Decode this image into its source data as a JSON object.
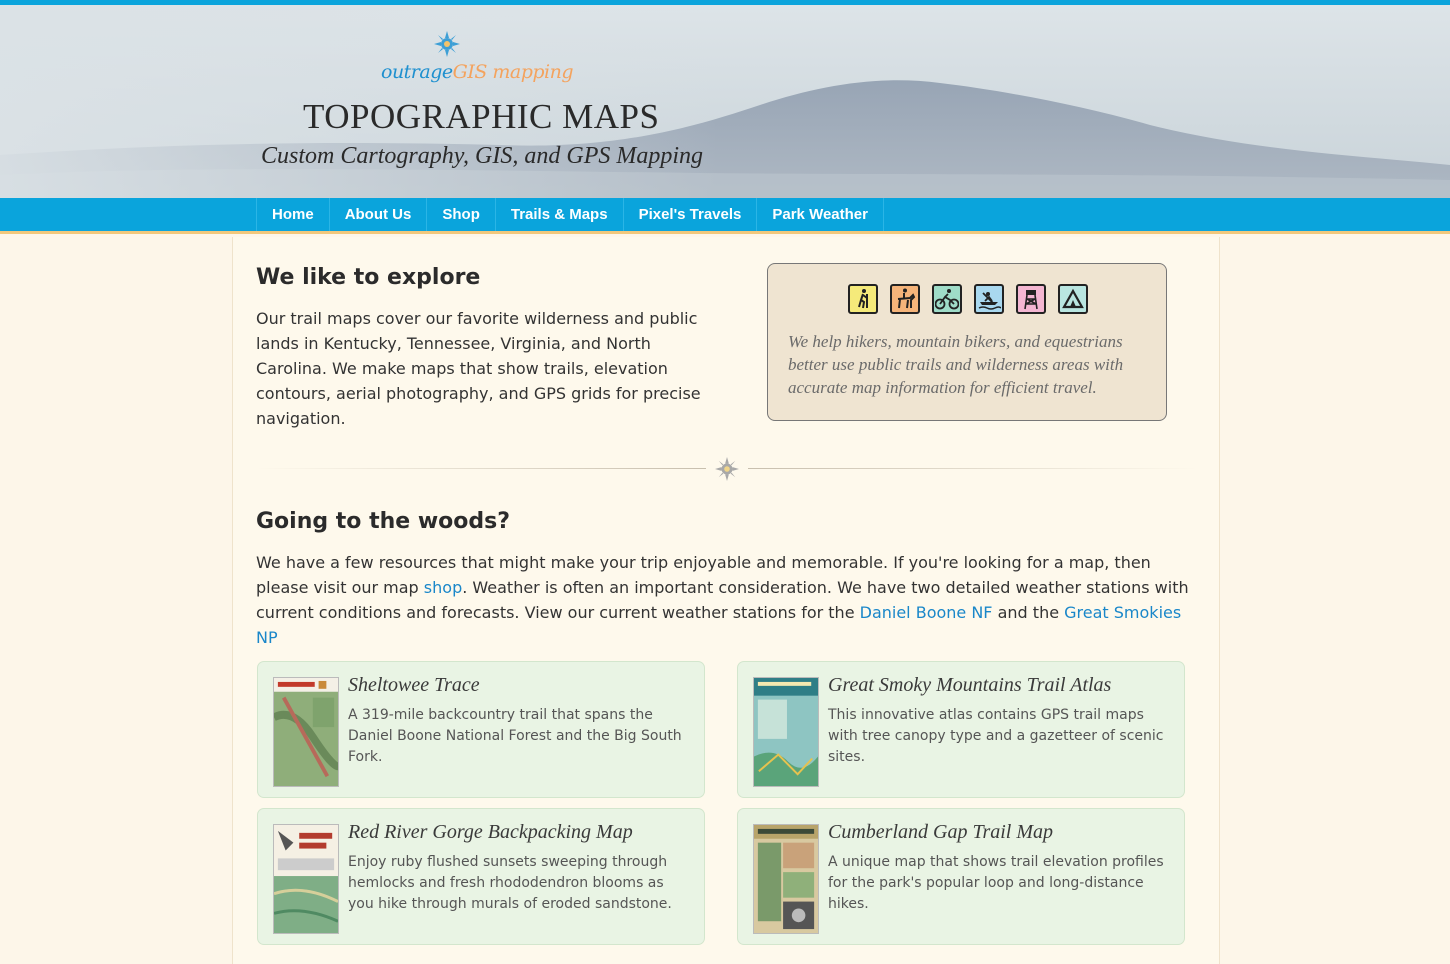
{
  "header": {
    "logo_part1": "outrage",
    "logo_part2": "GIS mapping",
    "title": "TOPOGRAPHIC MAPS",
    "subtitle": "Custom Cartography, GIS, and GPS Mapping"
  },
  "nav": {
    "items": [
      "Home",
      "About Us",
      "Shop",
      "Trails & Maps",
      "Pixel's Travels",
      "Park Weather"
    ]
  },
  "explore": {
    "heading": "We like to explore",
    "body": "Our trail maps cover our favorite wilderness and public lands in Kentucky, Tennessee, Virginia, and North Carolina. We make maps that show trails, elevation contours, aerial photography, and GPS grids for precise navigation."
  },
  "callout": {
    "icons": [
      {
        "name": "hiking-icon",
        "color": "#f5ea7a"
      },
      {
        "name": "horseback-icon",
        "color": "#f5b47a"
      },
      {
        "name": "biking-icon",
        "color": "#9fdcc8"
      },
      {
        "name": "boating-icon",
        "color": "#a9d8ef"
      },
      {
        "name": "firetower-icon",
        "color": "#f4b6d2"
      },
      {
        "name": "camping-icon",
        "color": "#b9e6e1"
      }
    ],
    "text": "We help hikers, mountain bikers, and equestrians better use public trails and wilderness areas with accurate map information for efficient travel."
  },
  "woods": {
    "heading": "Going to the woods?",
    "p1": "We have a few resources that might make your trip enjoyable and memorable. If you're looking for a map, then please visit our map ",
    "link_shop": "shop",
    "p2": ". Weather is often an important consideration. We have two detailed weather stations with current conditions and forecasts. View our current weather stations for the ",
    "link_boone": "Daniel Boone NF",
    "p3": " and the ",
    "link_smokies": "Great Smokies NP"
  },
  "cards": [
    {
      "title": "Sheltowee Trace",
      "desc": "A 319-mile backcountry trail that spans the Daniel Boone National Forest and the Big South Fork."
    },
    {
      "title": "Great Smoky Mountains Trail Atlas",
      "desc": "This innovative atlas contains GPS trail maps with tree canopy type and a gazetteer of scenic sites."
    },
    {
      "title": "Red River Gorge Backpacking Map",
      "desc": "Enjoy ruby flushed sunsets sweeping through hemlocks and fresh rhododendron blooms as you hike through murals of eroded sandstone."
    },
    {
      "title": "Cumberland Gap Trail Map",
      "desc": "A unique map that shows trail elevation profiles for the park's popular loop and long-distance hikes."
    }
  ],
  "colors": {
    "accent": "#0aa4dc",
    "page_bg": "#fdf6e9",
    "card_bg": "#e9f4e4",
    "link": "#1a87c9"
  }
}
